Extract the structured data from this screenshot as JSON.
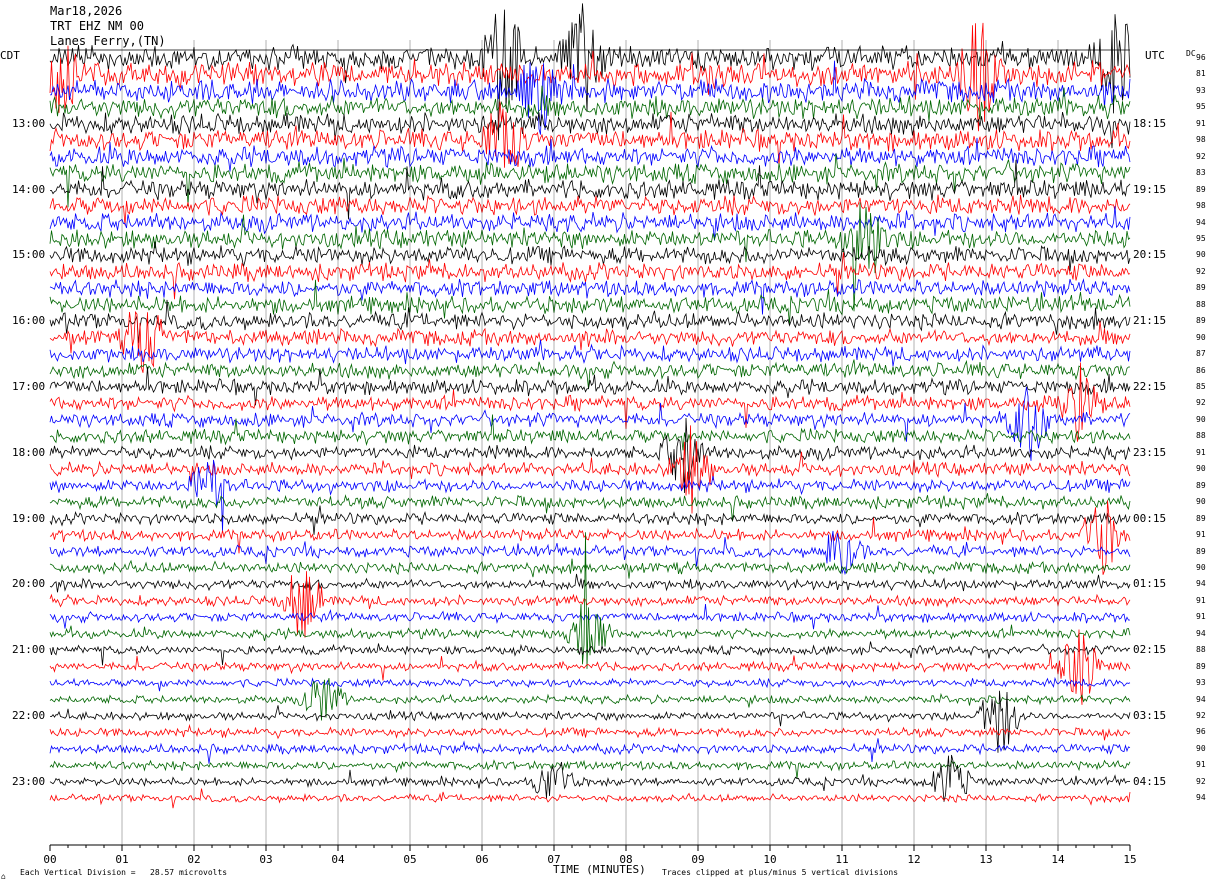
{
  "header": {
    "date": "Mar18,2026",
    "channel": "TRT EHZ NM 00",
    "location": "Lanes Ferry,(TN)"
  },
  "left_axis_label": "CDT",
  "right_axis_label": "UTC",
  "dc_label": "DC",
  "footer": {
    "corner_mark": "⌂",
    "scale_note": "Each Vertical Division =   28.57 microvolts",
    "clip_note": "Traces clipped at plus/minus 5 vertical divisions"
  },
  "chart_data": {
    "type": "line",
    "title": "",
    "xlabel": "TIME (MINUTES)",
    "xlim": [
      0,
      15
    ],
    "x_ticks": [
      "00",
      "01",
      "02",
      "03",
      "04",
      "05",
      "06",
      "07",
      "08",
      "09",
      "10",
      "11",
      "12",
      "13",
      "14",
      "15"
    ],
    "left_hour_labels": [
      "13:00",
      "14:00",
      "15:00",
      "16:00",
      "17:00",
      "18:00",
      "19:00",
      "20:00",
      "21:00",
      "22:00",
      "23:00"
    ],
    "right_hour_labels": [
      "18:15",
      "19:15",
      "20:15",
      "21:15",
      "22:15",
      "23:15",
      "00:15",
      "01:15",
      "02:15",
      "03:15",
      "04:15"
    ],
    "trace_colors": [
      "#000000",
      "#ff0000",
      "#0000ff",
      "#006600"
    ],
    "dc_offsets": [
      96,
      81,
      93,
      95,
      91,
      98,
      92,
      83,
      89,
      98,
      94,
      95,
      90,
      92,
      89,
      88,
      89,
      90,
      87,
      86,
      85,
      92,
      90,
      88,
      91,
      90,
      89,
      90,
      89,
      91,
      89,
      90,
      94,
      91,
      91,
      94,
      88,
      89,
      93,
      94,
      92,
      96,
      90,
      91,
      92,
      94
    ],
    "activity_levels": [
      3.2,
      3.1,
      3.0,
      2.9,
      2.8,
      2.8,
      2.7,
      2.7,
      2.6,
      2.6,
      2.5,
      2.5,
      2.4,
      2.4,
      2.3,
      2.3,
      2.2,
      2.2,
      2.1,
      2.1,
      2.0,
      2.0,
      1.9,
      1.9,
      1.8,
      1.8,
      1.7,
      1.7,
      1.6,
      1.6,
      1.5,
      1.5,
      1.4,
      1.4,
      1.3,
      1.3,
      1.2,
      1.2,
      1.1,
      1.1,
      1.1,
      1.2,
      1.3,
      1.2,
      1.1,
      1.0
    ],
    "bursts": [
      {
        "trace": 0,
        "minute": 6.3,
        "strength": 4
      },
      {
        "trace": 0,
        "minute": 7.4,
        "strength": 4
      },
      {
        "trace": 0,
        "minute": 14.8,
        "strength": 4
      },
      {
        "trace": 1,
        "minute": 0.2,
        "strength": 3
      },
      {
        "trace": 1,
        "minute": 12.9,
        "strength": 4
      },
      {
        "trace": 2,
        "minute": 6.8,
        "strength": 3
      },
      {
        "trace": 5,
        "minute": 6.3,
        "strength": 3
      },
      {
        "trace": 11,
        "minute": 11.3,
        "strength": 4
      },
      {
        "trace": 17,
        "minute": 1.3,
        "strength": 3
      },
      {
        "trace": 21,
        "minute": 14.3,
        "strength": 3
      },
      {
        "trace": 22,
        "minute": 13.6,
        "strength": 3
      },
      {
        "trace": 24,
        "minute": 8.8,
        "strength": 3
      },
      {
        "trace": 25,
        "minute": 8.9,
        "strength": 3
      },
      {
        "trace": 26,
        "minute": 2.2,
        "strength": 2
      },
      {
        "trace": 29,
        "minute": 14.6,
        "strength": 3
      },
      {
        "trace": 30,
        "minute": 11.0,
        "strength": 2
      },
      {
        "trace": 33,
        "minute": 3.5,
        "strength": 3
      },
      {
        "trace": 35,
        "minute": 7.5,
        "strength": 3
      },
      {
        "trace": 37,
        "minute": 14.3,
        "strength": 3
      },
      {
        "trace": 39,
        "minute": 3.8,
        "strength": 2
      },
      {
        "trace": 40,
        "minute": 13.2,
        "strength": 3
      },
      {
        "trace": 44,
        "minute": 7.0,
        "strength": 2
      },
      {
        "trace": 44,
        "minute": 12.5,
        "strength": 2
      }
    ]
  }
}
